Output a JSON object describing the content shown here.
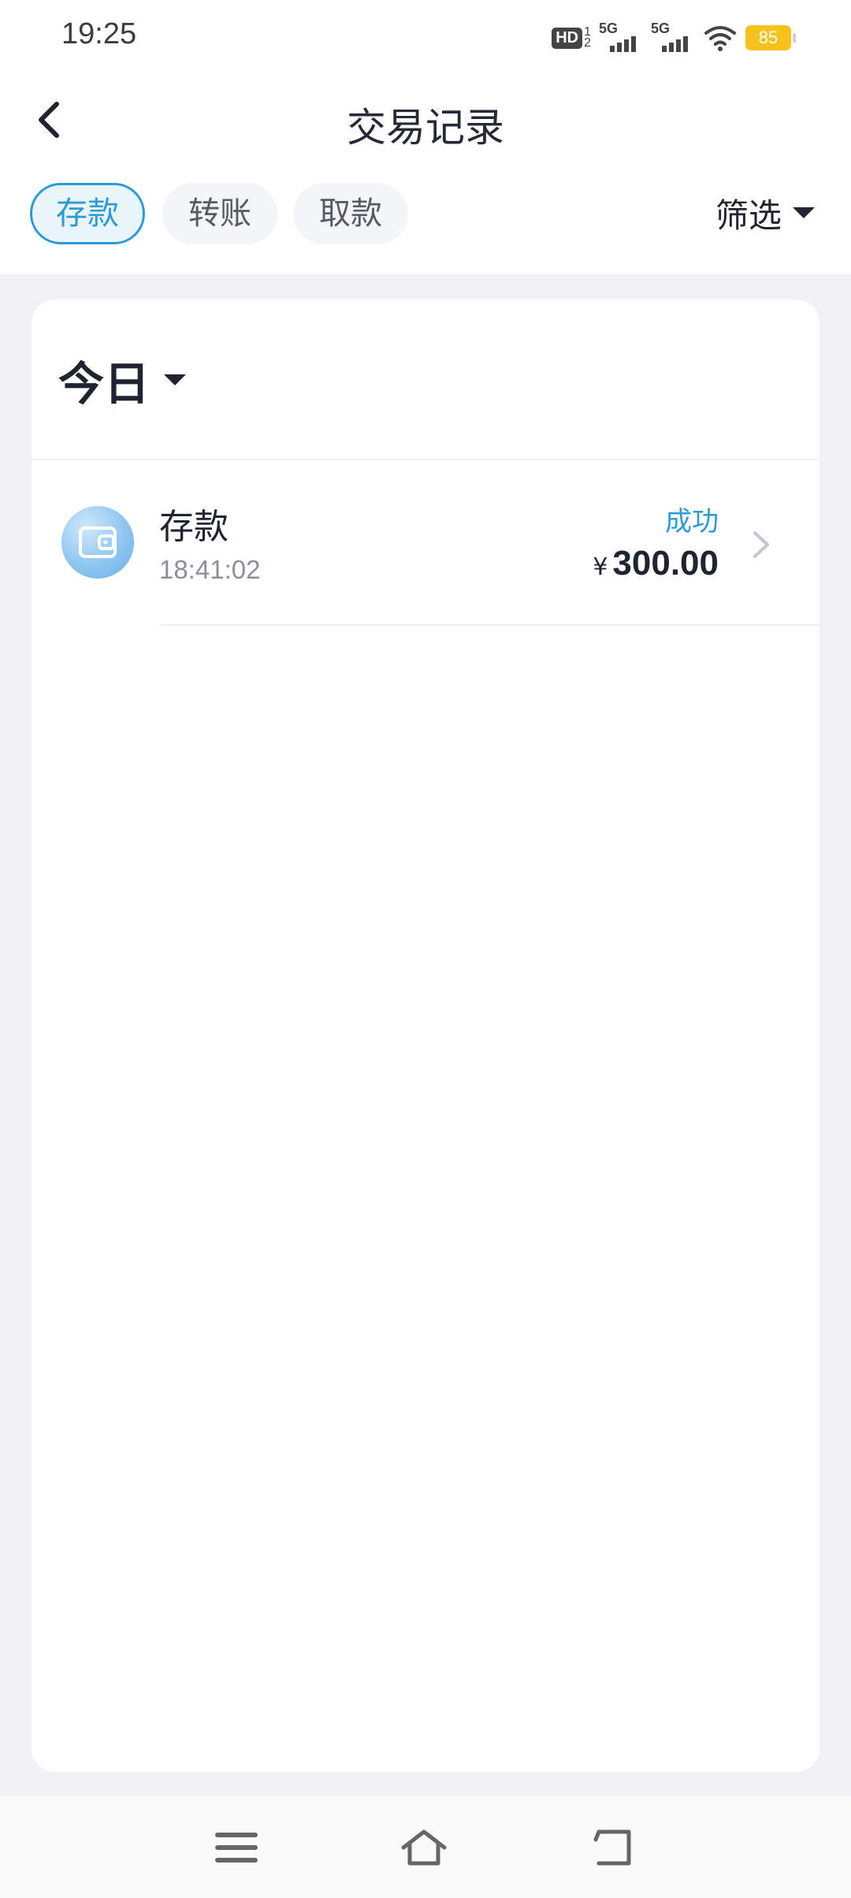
{
  "status_bar": {
    "time": "19:25",
    "hd_label": "HD",
    "hd_sup": "1",
    "hd_sub": "2",
    "signal_1_label": "5G",
    "signal_2_label": "5G",
    "battery": "85"
  },
  "header": {
    "title": "交易记录"
  },
  "tabs": [
    {
      "label": "存款",
      "active": true
    },
    {
      "label": "转账",
      "active": false
    },
    {
      "label": "取款",
      "active": false
    }
  ],
  "filter": {
    "label": "筛选"
  },
  "day_group": {
    "label": "今日"
  },
  "transactions": [
    {
      "name": "存款",
      "time": "18:41:02",
      "status": "成功",
      "currency": "¥",
      "amount": "300.00",
      "icon": "wallet-icon"
    }
  ],
  "colors": {
    "accent": "#2a9bd6",
    "background": "#f2f2f6",
    "battery": "#f6c21c"
  }
}
